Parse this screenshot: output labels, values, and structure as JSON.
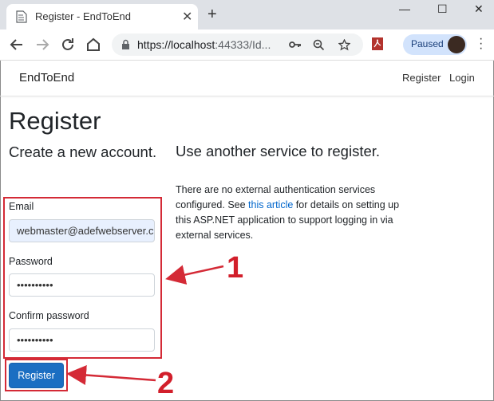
{
  "browser": {
    "tab_title": "Register - EndToEnd",
    "tab_close": "✕",
    "new_tab": "+",
    "url_host": "https://localhost",
    "url_rest": ":44333/Id...",
    "profile_status": "Paused",
    "window_controls": {
      "minimize": "—",
      "maximize": "☐",
      "close": "✕"
    }
  },
  "navbar": {
    "brand": "EndToEnd",
    "links": [
      "Register",
      "Login"
    ]
  },
  "page": {
    "heading": "Register",
    "left_subheading": "Create a new account.",
    "right_subheading": "Use another service to register.",
    "info_before": "There are no external authentication services configured. See ",
    "info_link": "this article",
    "info_after": " for details on setting up this ASP.NET application to support logging in via external services."
  },
  "form": {
    "email_label": "Email",
    "email_value": "webmaster@adefwebserver.c",
    "password_label": "Password",
    "password_value": "••••••••••",
    "confirm_label": "Confirm password",
    "confirm_value": "••••••••••",
    "submit_label": "Register"
  },
  "annotations": {
    "first": "1",
    "second": "2"
  },
  "colors": {
    "accent": "#1b6ec2",
    "annotation": "#d42a36"
  }
}
